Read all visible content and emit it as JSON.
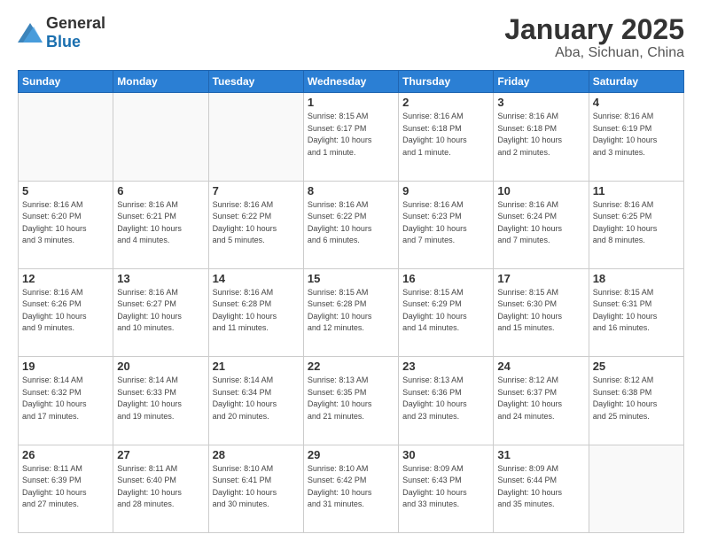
{
  "header": {
    "logo_general": "General",
    "logo_blue": "Blue",
    "month_title": "January 2025",
    "location": "Aba, Sichuan, China"
  },
  "calendar": {
    "days_of_week": [
      "Sunday",
      "Monday",
      "Tuesday",
      "Wednesday",
      "Thursday",
      "Friday",
      "Saturday"
    ],
    "weeks": [
      [
        {
          "day": "",
          "info": ""
        },
        {
          "day": "",
          "info": ""
        },
        {
          "day": "",
          "info": ""
        },
        {
          "day": "1",
          "info": "Sunrise: 8:15 AM\nSunset: 6:17 PM\nDaylight: 10 hours\nand 1 minute."
        },
        {
          "day": "2",
          "info": "Sunrise: 8:16 AM\nSunset: 6:18 PM\nDaylight: 10 hours\nand 1 minute."
        },
        {
          "day": "3",
          "info": "Sunrise: 8:16 AM\nSunset: 6:18 PM\nDaylight: 10 hours\nand 2 minutes."
        },
        {
          "day": "4",
          "info": "Sunrise: 8:16 AM\nSunset: 6:19 PM\nDaylight: 10 hours\nand 3 minutes."
        }
      ],
      [
        {
          "day": "5",
          "info": "Sunrise: 8:16 AM\nSunset: 6:20 PM\nDaylight: 10 hours\nand 3 minutes."
        },
        {
          "day": "6",
          "info": "Sunrise: 8:16 AM\nSunset: 6:21 PM\nDaylight: 10 hours\nand 4 minutes."
        },
        {
          "day": "7",
          "info": "Sunrise: 8:16 AM\nSunset: 6:22 PM\nDaylight: 10 hours\nand 5 minutes."
        },
        {
          "day": "8",
          "info": "Sunrise: 8:16 AM\nSunset: 6:22 PM\nDaylight: 10 hours\nand 6 minutes."
        },
        {
          "day": "9",
          "info": "Sunrise: 8:16 AM\nSunset: 6:23 PM\nDaylight: 10 hours\nand 7 minutes."
        },
        {
          "day": "10",
          "info": "Sunrise: 8:16 AM\nSunset: 6:24 PM\nDaylight: 10 hours\nand 7 minutes."
        },
        {
          "day": "11",
          "info": "Sunrise: 8:16 AM\nSunset: 6:25 PM\nDaylight: 10 hours\nand 8 minutes."
        }
      ],
      [
        {
          "day": "12",
          "info": "Sunrise: 8:16 AM\nSunset: 6:26 PM\nDaylight: 10 hours\nand 9 minutes."
        },
        {
          "day": "13",
          "info": "Sunrise: 8:16 AM\nSunset: 6:27 PM\nDaylight: 10 hours\nand 10 minutes."
        },
        {
          "day": "14",
          "info": "Sunrise: 8:16 AM\nSunset: 6:28 PM\nDaylight: 10 hours\nand 11 minutes."
        },
        {
          "day": "15",
          "info": "Sunrise: 8:15 AM\nSunset: 6:28 PM\nDaylight: 10 hours\nand 12 minutes."
        },
        {
          "day": "16",
          "info": "Sunrise: 8:15 AM\nSunset: 6:29 PM\nDaylight: 10 hours\nand 14 minutes."
        },
        {
          "day": "17",
          "info": "Sunrise: 8:15 AM\nSunset: 6:30 PM\nDaylight: 10 hours\nand 15 minutes."
        },
        {
          "day": "18",
          "info": "Sunrise: 8:15 AM\nSunset: 6:31 PM\nDaylight: 10 hours\nand 16 minutes."
        }
      ],
      [
        {
          "day": "19",
          "info": "Sunrise: 8:14 AM\nSunset: 6:32 PM\nDaylight: 10 hours\nand 17 minutes."
        },
        {
          "day": "20",
          "info": "Sunrise: 8:14 AM\nSunset: 6:33 PM\nDaylight: 10 hours\nand 19 minutes."
        },
        {
          "day": "21",
          "info": "Sunrise: 8:14 AM\nSunset: 6:34 PM\nDaylight: 10 hours\nand 20 minutes."
        },
        {
          "day": "22",
          "info": "Sunrise: 8:13 AM\nSunset: 6:35 PM\nDaylight: 10 hours\nand 21 minutes."
        },
        {
          "day": "23",
          "info": "Sunrise: 8:13 AM\nSunset: 6:36 PM\nDaylight: 10 hours\nand 23 minutes."
        },
        {
          "day": "24",
          "info": "Sunrise: 8:12 AM\nSunset: 6:37 PM\nDaylight: 10 hours\nand 24 minutes."
        },
        {
          "day": "25",
          "info": "Sunrise: 8:12 AM\nSunset: 6:38 PM\nDaylight: 10 hours\nand 25 minutes."
        }
      ],
      [
        {
          "day": "26",
          "info": "Sunrise: 8:11 AM\nSunset: 6:39 PM\nDaylight: 10 hours\nand 27 minutes."
        },
        {
          "day": "27",
          "info": "Sunrise: 8:11 AM\nSunset: 6:40 PM\nDaylight: 10 hours\nand 28 minutes."
        },
        {
          "day": "28",
          "info": "Sunrise: 8:10 AM\nSunset: 6:41 PM\nDaylight: 10 hours\nand 30 minutes."
        },
        {
          "day": "29",
          "info": "Sunrise: 8:10 AM\nSunset: 6:42 PM\nDaylight: 10 hours\nand 31 minutes."
        },
        {
          "day": "30",
          "info": "Sunrise: 8:09 AM\nSunset: 6:43 PM\nDaylight: 10 hours\nand 33 minutes."
        },
        {
          "day": "31",
          "info": "Sunrise: 8:09 AM\nSunset: 6:44 PM\nDaylight: 10 hours\nand 35 minutes."
        },
        {
          "day": "",
          "info": ""
        }
      ]
    ]
  }
}
